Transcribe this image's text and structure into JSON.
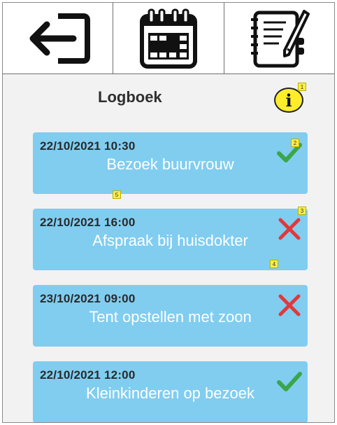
{
  "header": {
    "buttons": [
      {
        "icon": "logout-icon"
      },
      {
        "icon": "calendar-icon"
      },
      {
        "icon": "notebook-pen-icon"
      }
    ]
  },
  "page": {
    "title": "Logboek",
    "info_label": "i"
  },
  "badges": [
    "1",
    "2",
    "3",
    "4",
    "5"
  ],
  "entries": [
    {
      "datetime": "22/10/2021 10:30",
      "title": "Bezoek buurvrouw",
      "status": "done",
      "status_icon": "checkmark-icon"
    },
    {
      "datetime": "22/10/2021 16:00",
      "title": "Afspraak bij huisdokter",
      "status": "not-done",
      "status_icon": "cross-icon"
    },
    {
      "datetime": "23/10/2021 09:00",
      "title": "Tent opstellen met zoon",
      "status": "not-done",
      "status_icon": "cross-icon"
    },
    {
      "datetime": "22/10/2021 12:00",
      "title": "Kleinkinderen op bezoek",
      "status": "done",
      "status_icon": "checkmark-icon"
    }
  ],
  "colors": {
    "card": "#80cdf0",
    "check": "#3aa64a",
    "cross": "#e2383b",
    "info": "#ffed2b",
    "background": "#f2f2f2"
  }
}
